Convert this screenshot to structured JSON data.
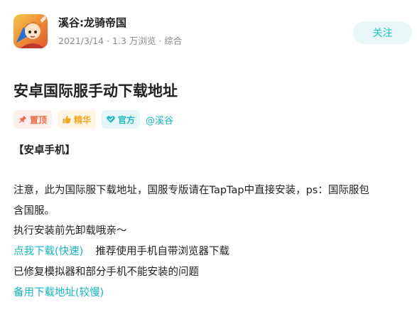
{
  "header": {
    "app_name": "溪谷:龙骑帝国",
    "meta": "2021/3/14 · 1.3 万浏览 · 综合",
    "follow_label": "关注"
  },
  "post": {
    "title": "安卓国际服手动下载地址",
    "tags": {
      "pinned": "置顶",
      "featured": "精华",
      "official": "官方"
    },
    "author": "@溪谷",
    "body": {
      "heading": "【安卓手机】",
      "note_line1": "注意，此为国际服下载地址，国服专版请在TapTap中直接安装，ps：国际服包",
      "note_line2": "含国服。",
      "uninstall": "执行安装前先卸载哦亲～",
      "download_fast": "点我下载(快速)",
      "download_tip": "推荐使用手机自带浏览器下载",
      "fixed_note": "已修复模拟器和部分手机不能安装的问题",
      "download_backup": "备用下载地址(较慢)"
    }
  },
  "colors": {
    "accent": "#15b6c4",
    "pinned": "#f06a4b",
    "featured": "#f5a623",
    "official": "#17b8c4"
  }
}
